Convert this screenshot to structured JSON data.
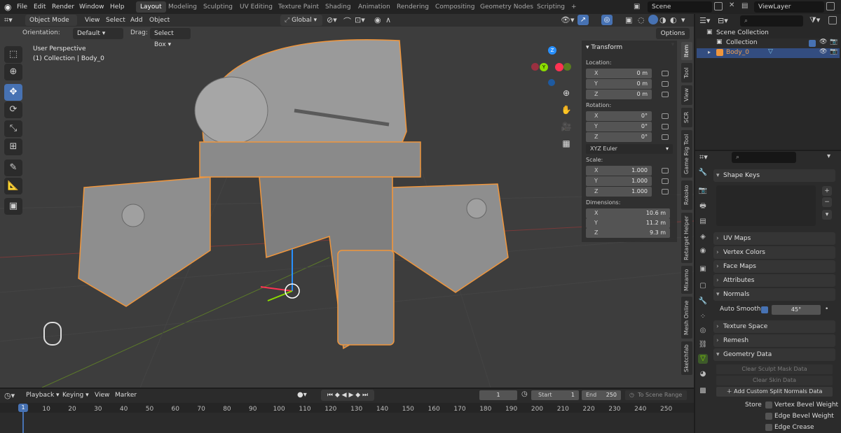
{
  "topbar": {
    "menus": [
      "File",
      "Edit",
      "Render",
      "Window",
      "Help"
    ],
    "workspaces": [
      "Layout",
      "Modeling",
      "Sculpting",
      "UV Editing",
      "Texture Paint",
      "Shading",
      "Animation",
      "Rendering",
      "Compositing",
      "Geometry Nodes",
      "Scripting"
    ],
    "active_workspace": "Layout",
    "add_tab": "+",
    "scene": "Scene",
    "view_layer": "ViewLayer"
  },
  "viewport_header": {
    "mode": "Object Mode",
    "menus": [
      "View",
      "Select",
      "Add",
      "Object"
    ],
    "transform_orientation": "Global",
    "orientation_label": "Orientation:",
    "orientation_value": "Default",
    "drag_label": "Drag:",
    "drag_value": "Select Box",
    "options": "Options"
  },
  "viewport": {
    "view_name": "User Perspective",
    "context": "(1) Collection | Body_0",
    "gizmo_axes": [
      "X",
      "Y",
      "Z"
    ],
    "colors": {
      "bg": "#3d3d3d",
      "x_axis": "#ff3352",
      "y_axis": "#8bdc00",
      "z_axis": "#2890ff",
      "selection": "#f0963c"
    }
  },
  "transform": {
    "title": "Transform",
    "location_label": "Location:",
    "location": [
      {
        "axis": "X",
        "value": "0 m"
      },
      {
        "axis": "Y",
        "value": "0 m"
      },
      {
        "axis": "Z",
        "value": "0 m"
      }
    ],
    "rotation_label": "Rotation:",
    "rotation": [
      {
        "axis": "X",
        "value": "0°"
      },
      {
        "axis": "Y",
        "value": "0°"
      },
      {
        "axis": "Z",
        "value": "0°"
      }
    ],
    "rotation_mode": "XYZ Euler",
    "scale_label": "Scale:",
    "scale": [
      {
        "axis": "X",
        "value": "1.000"
      },
      {
        "axis": "Y",
        "value": "1.000"
      },
      {
        "axis": "Z",
        "value": "1.000"
      }
    ],
    "dimensions_label": "Dimensions:",
    "dimensions": [
      {
        "axis": "X",
        "value": "10.6 m"
      },
      {
        "axis": "Y",
        "value": "11.2 m"
      },
      {
        "axis": "Z",
        "value": "9.3 m"
      }
    ]
  },
  "sidebar_tabs": [
    "Item",
    "Tool",
    "View",
    "SCR",
    "Game Rig Tool",
    "Rokoko",
    "Retarget Helper",
    "Mixamo",
    "Mesh Online",
    "Sketchfab"
  ],
  "outliner": {
    "root": "Scene Collection",
    "collection": "Collection",
    "object": "Body_0"
  },
  "properties": {
    "shape_keys": "Shape Keys",
    "uv_maps": "UV Maps",
    "vertex_colors": "Vertex Colors",
    "face_maps": "Face Maps",
    "attributes": "Attributes",
    "normals": "Normals",
    "auto_smooth_label": "Auto Smooth",
    "auto_smooth_angle": "45°",
    "texture_space": "Texture Space",
    "remesh": "Remesh",
    "geometry_data": "Geometry Data",
    "clear_sculpt_mask": "Clear Sculpt Mask Data",
    "clear_skin": "Clear Skin Data",
    "add_custom_split": "Add Custom Split Normals Data",
    "store_label": "Store",
    "vertex_bevel_weight": "Vertex Bevel Weight",
    "edge_bevel_weight": "Edge Bevel Weight",
    "edge_crease": "Edge Crease"
  },
  "timeline": {
    "menus": [
      "Playback",
      "Keying",
      "View",
      "Marker"
    ],
    "current_frame": "1",
    "start_label": "Start",
    "start": "1",
    "end_label": "End",
    "end": "250",
    "to_scene_range": "To Scene Range",
    "ticks": [
      "1",
      "10",
      "20",
      "30",
      "40",
      "50",
      "60",
      "70",
      "80",
      "90",
      "100",
      "110",
      "120",
      "130",
      "140",
      "150",
      "160",
      "170",
      "180",
      "190",
      "200",
      "210",
      "220",
      "230",
      "240",
      "250"
    ]
  }
}
